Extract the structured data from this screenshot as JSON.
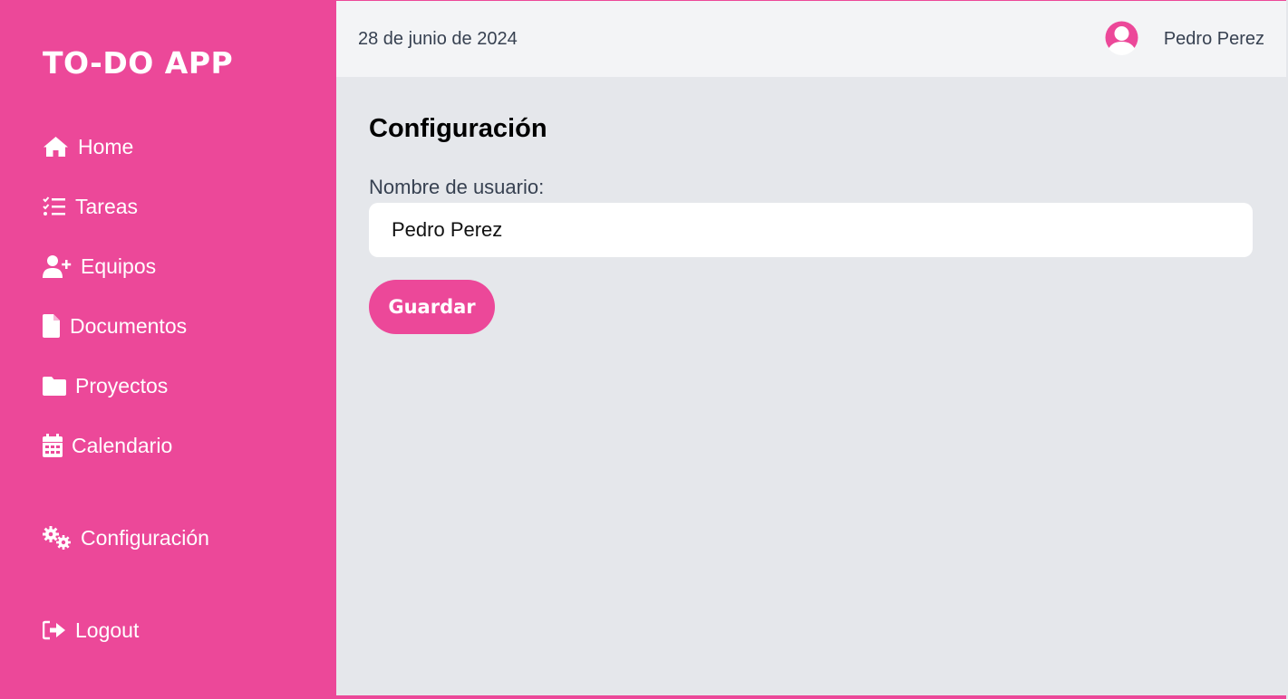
{
  "app": {
    "title": "TO-DO APP",
    "accent_color": "#ec4899"
  },
  "sidebar": {
    "items": [
      {
        "label": "Home",
        "icon": "home-icon"
      },
      {
        "label": "Tareas",
        "icon": "task-list-icon"
      },
      {
        "label": "Equipos",
        "icon": "user-plus-icon"
      },
      {
        "label": "Documentos",
        "icon": "file-icon"
      },
      {
        "label": "Proyectos",
        "icon": "folder-icon"
      },
      {
        "label": "Calendario",
        "icon": "calendar-icon"
      },
      {
        "label": "Configuración",
        "icon": "gears-icon"
      },
      {
        "label": "Logout",
        "icon": "logout-icon"
      }
    ]
  },
  "header": {
    "date": "28 de junio de 2024",
    "user_name": "Pedro Perez",
    "avatar_icon": "user-avatar-icon"
  },
  "main": {
    "title": "Configuración",
    "username_label": "Nombre de usuario:",
    "username_value": "Pedro Perez",
    "save_label": "Guardar"
  }
}
